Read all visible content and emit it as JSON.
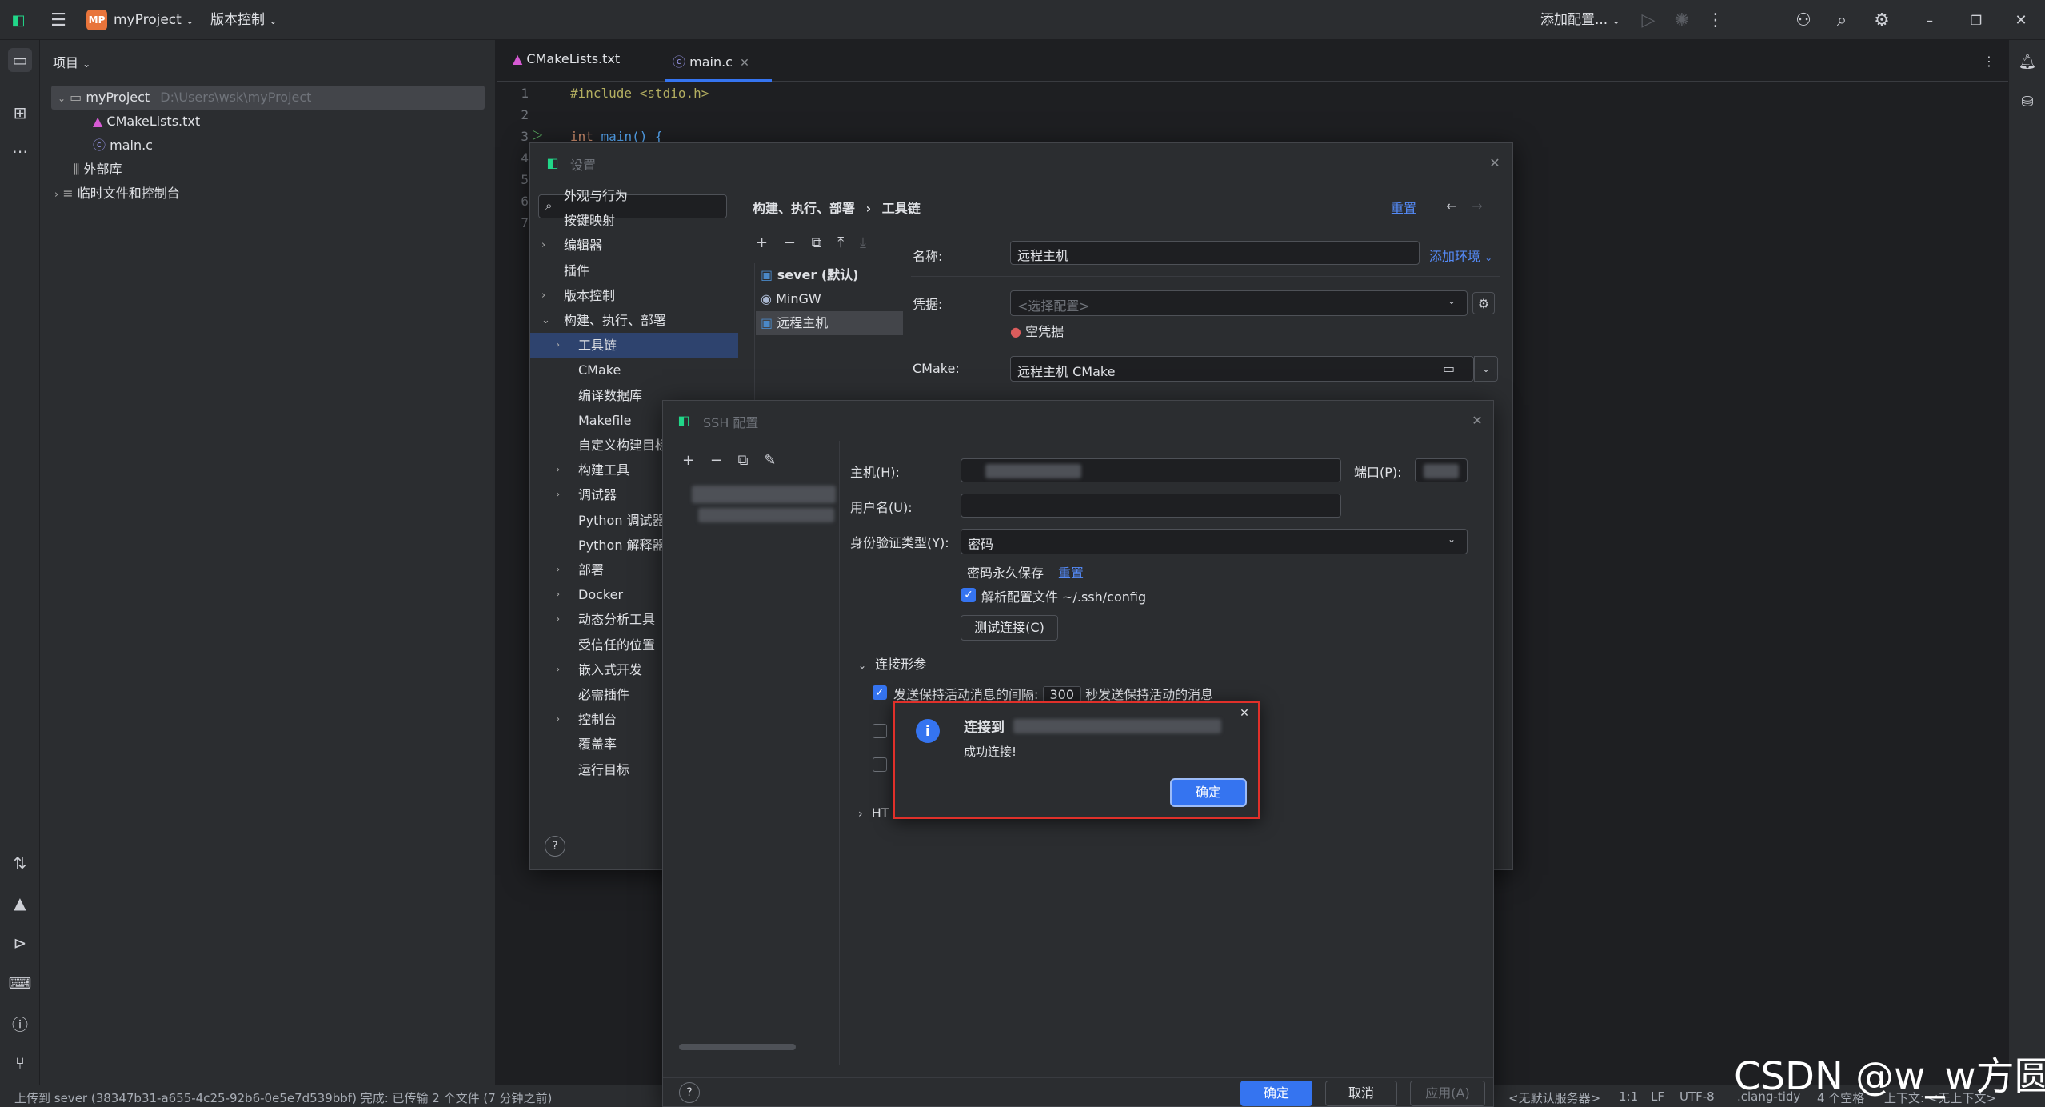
{
  "titlebar": {
    "project_badge": "MP",
    "project_name": "myProject",
    "vcs_menu": "版本控制",
    "add_config": "添加配置..."
  },
  "project_panel": {
    "header": "项目",
    "root_name": "myProject",
    "root_path": "D:\\Users\\wsk\\myProject",
    "files": [
      "CMakeLists.txt",
      "main.c"
    ],
    "external_libs": "外部库",
    "scratches": "临时文件和控制台"
  },
  "editor": {
    "tabs": [
      {
        "label": "CMakeLists.txt",
        "active": false
      },
      {
        "label": "main.c",
        "active": true
      }
    ],
    "line_numbers": [
      "1",
      "2",
      "3",
      "4",
      "5",
      "6",
      "7"
    ],
    "line1": "#include <stdio.h>",
    "line3_kw": "int",
    "line3_fn": "main() {"
  },
  "settings": {
    "title": "设置",
    "search_placeholder": "",
    "breadcrumb_1": "构建、执行、部署",
    "breadcrumb_sep": "›",
    "breadcrumb_2": "工具链",
    "reset": "重置",
    "nav": [
      {
        "label": "外观与行为",
        "indent": 0,
        "arrow": false,
        "sel": false
      },
      {
        "label": "按键映射",
        "indent": 0,
        "arrow": false,
        "sel": false
      },
      {
        "label": "编辑器",
        "indent": 0,
        "arrow": true,
        "sel": false
      },
      {
        "label": "插件",
        "indent": 0,
        "arrow": false,
        "sel": false
      },
      {
        "label": "版本控制",
        "indent": 0,
        "arrow": true,
        "sel": false
      },
      {
        "label": "构建、执行、部署",
        "indent": 0,
        "arrow": true,
        "sel": false,
        "open": true
      },
      {
        "label": "工具链",
        "indent": 1,
        "arrow": true,
        "sel": true
      },
      {
        "label": "CMake",
        "indent": 1,
        "arrow": false,
        "sel": false
      },
      {
        "label": "编译数据库",
        "indent": 1,
        "arrow": false,
        "sel": false
      },
      {
        "label": "Makefile",
        "indent": 1,
        "arrow": false,
        "sel": false
      },
      {
        "label": "自定义构建目标",
        "indent": 1,
        "arrow": false,
        "sel": false
      },
      {
        "label": "构建工具",
        "indent": 1,
        "arrow": true,
        "sel": false
      },
      {
        "label": "调试器",
        "indent": 1,
        "arrow": true,
        "sel": false
      },
      {
        "label": "Python 调试器",
        "indent": 1,
        "arrow": false,
        "sel": false
      },
      {
        "label": "Python 解释器",
        "indent": 1,
        "arrow": false,
        "sel": false
      },
      {
        "label": "部署",
        "indent": 1,
        "arrow": true,
        "sel": false
      },
      {
        "label": "Docker",
        "indent": 1,
        "arrow": true,
        "sel": false
      },
      {
        "label": "动态分析工具",
        "indent": 1,
        "arrow": true,
        "sel": false
      },
      {
        "label": "受信任的位置",
        "indent": 1,
        "arrow": false,
        "sel": false
      },
      {
        "label": "嵌入式开发",
        "indent": 1,
        "arrow": true,
        "sel": false
      },
      {
        "label": "必需插件",
        "indent": 1,
        "arrow": false,
        "sel": false
      },
      {
        "label": "控制台",
        "indent": 1,
        "arrow": true,
        "sel": false
      },
      {
        "label": "覆盖率",
        "indent": 1,
        "arrow": false,
        "sel": false
      },
      {
        "label": "运行目标",
        "indent": 1,
        "arrow": false,
        "sel": false
      }
    ],
    "toolchains": [
      {
        "label": "sever (默认)",
        "sel": false
      },
      {
        "label": "MinGW",
        "sel": false
      },
      {
        "label": "远程主机",
        "sel": true
      }
    ],
    "name_label": "名称:",
    "name_value": "远程主机",
    "add_env": "添加环境",
    "credentials_label": "凭据:",
    "credentials_placeholder": "<选择配置>",
    "credentials_error": "空凭据",
    "cmake_label": "CMake:",
    "cmake_value": "远程主机 CMake"
  },
  "ssh": {
    "title": "SSH 配置",
    "host_label": "主机(H):",
    "port_label": "端口(P):",
    "user_label": "用户名(U):",
    "auth_label": "身份验证类型(Y):",
    "auth_value": "密码",
    "save_password": "密码永久保存",
    "reset": "重置",
    "parse_config": "解析配置文件 ~/.ssh/config",
    "test_conn": "测试连接(C)",
    "conn_section": "连接形参",
    "keepalive_prefix": "发送保持活动消息的间隔:",
    "keepalive_value": "300",
    "keepalive_suffix": "秒发送保持活动的消息",
    "http_section": "HT",
    "ok": "确定",
    "cancel": "取消",
    "apply": "应用(A)"
  },
  "popup": {
    "title": "连接到",
    "message": "成功连接!",
    "ok": "确定"
  },
  "statusbar": {
    "message": "上传到 sever (38347b31-a655-4c25-92b6-0e5e7d539bbf) 完成: 已传输 2 个文件 (7 分钟之前)",
    "server": "<无默认服务器>",
    "position": "1:1",
    "line_sep": "LF",
    "encoding": "UTF-8",
    "linter": ".clang-tidy",
    "indent": "4 个空格",
    "context": "上下文: <无上下文>"
  },
  "watermark": "CSDN @w_w方圆",
  "colors": {
    "accent": "#3574f0",
    "error": "#db5c5c",
    "highlight_border": "#e0302a"
  }
}
